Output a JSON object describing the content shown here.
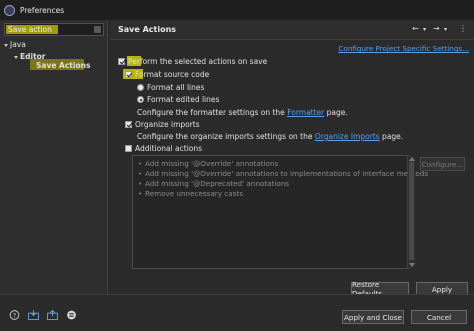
{
  "window": {
    "title": "Preferences"
  },
  "filter": {
    "value": "Save action"
  },
  "tree": {
    "java": "Java",
    "editor": "Editor",
    "save_actions": "Save Actions"
  },
  "header": {
    "title": "Save Actions",
    "back_arrow": "←",
    "back_menu": "▾",
    "forward_arrow": "→",
    "forward_menu": "▾",
    "menu": "⋮"
  },
  "content": {
    "configure_link": "Configure Project Specific Settings...",
    "perform_label_prefix": "Perf",
    "perform_label_rest": "orm the selected actions on save",
    "format_label_hl": "Fo",
    "format_label_rest": "rmat source code",
    "format_all": "Format all lines",
    "format_edited": "Format edited lines",
    "formatter_text_before": "Configure the formatter settings on the ",
    "formatter_link": "Formatter",
    "formatter_text_after": " page.",
    "organize_label": "Organize imports",
    "organize_text_before": "Configure the organize imports settings on the ",
    "organize_link": "Organize Imports",
    "organize_text_after": " page.",
    "additional_label": "Additional actions",
    "additional_items": [
      "Add missing '@Override' annotations",
      "Add missing '@Override' annotations to implementations of interface methods",
      "Add missing '@Deprecated' annotations",
      "Remove unnecessary casts"
    ],
    "configure_button": "Configure...",
    "restore_defaults": "Restore Defaults",
    "apply": "Apply"
  },
  "footer": {
    "apply_and_close": "Apply and Close",
    "cancel": "Cancel"
  },
  "colors": {
    "highlight": "#c6c20e",
    "link": "#5aa0e6",
    "background": "#2b2b2b"
  }
}
